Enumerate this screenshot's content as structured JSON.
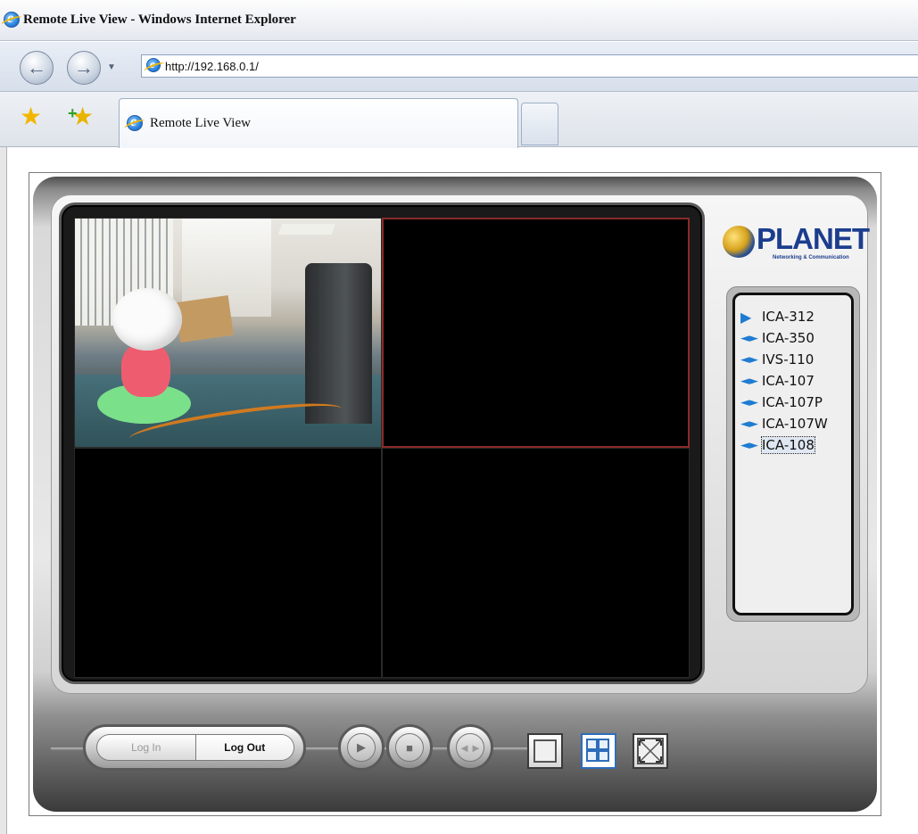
{
  "window": {
    "title": "Remote Live View - Windows Internet Explorer"
  },
  "nav": {
    "url": "http://192.168.0.1/",
    "back_icon": "back-arrow-icon",
    "forward_icon": "forward-arrow-icon"
  },
  "tabs": [
    {
      "label": "Remote Live View",
      "active": true
    }
  ],
  "app": {
    "logo": {
      "name": "PLANET",
      "tagline": "Networking & Communication"
    },
    "cameras": [
      {
        "label": "ICA-312",
        "icon": "play-triangle-icon",
        "status": "playing"
      },
      {
        "label": "ICA-350",
        "icon": "camera-speaker-icon"
      },
      {
        "label": "IVS-110",
        "icon": "camera-speaker-icon"
      },
      {
        "label": "ICA-107",
        "icon": "camera-speaker-icon"
      },
      {
        "label": "ICA-107P",
        "icon": "camera-speaker-icon"
      },
      {
        "label": "ICA-107W",
        "icon": "camera-speaker-icon"
      },
      {
        "label": "ICA-108",
        "icon": "camera-speaker-icon",
        "focused": true
      }
    ],
    "controls": {
      "login_label": "Log In",
      "logout_label": "Log Out",
      "view_mode": "quad"
    }
  },
  "colors": {
    "selected_cell_border": "#8a2a28",
    "active_view_border": "#2e6dba"
  }
}
